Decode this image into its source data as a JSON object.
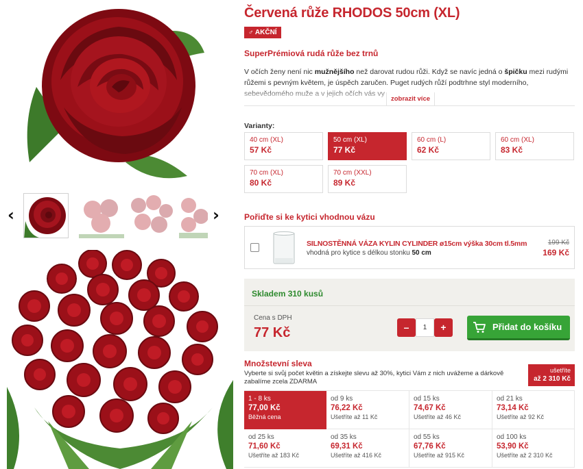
{
  "product": {
    "title": "Červená růže RHODOS 50cm (XL)",
    "badge": "♂ AKČNÍ",
    "subtitle": "SuperPrémiová rudá růže bez trnů",
    "description_parts": {
      "p1": "V očích ženy není nic ",
      "b1": "mužnějšího",
      "p2": " než darovat rudou růži. Když se navíc jedná o ",
      "b2": "špičku",
      "p3": " mezi rudými růžemi s pevným květem, je úspěch zaručen. Puget rudých růží podtrhne styl moderního, sebevědomého muže a v jejich očích vás vy"
    },
    "show_more": "zobrazit více"
  },
  "gallery": {
    "prev_arrow": "‹",
    "next_arrow": "›"
  },
  "variants": {
    "label": "Varianty:",
    "items": [
      {
        "size": "40 cm (XL)",
        "price": "57 Kč",
        "selected": false
      },
      {
        "size": "50 cm (XL)",
        "price": "77 Kč",
        "selected": true
      },
      {
        "size": "60 cm (L)",
        "price": "62 Kč",
        "selected": false
      },
      {
        "size": "60 cm (XL)",
        "price": "83 Kč",
        "selected": false
      },
      {
        "size": "70 cm (XL)",
        "price": "80 Kč",
        "selected": false
      },
      {
        "size": "70 cm (XXL)",
        "price": "89 Kč",
        "selected": false
      }
    ]
  },
  "vase": {
    "heading": "Pořiďte si ke kytici vhodnou vázu",
    "name": "SILNOSTĚNNÁ VÁZA KYLIN CYLINDER ø15cm výška 30cm tl.5mm",
    "note_prefix": "vhodná pro kytice s délkou stonku ",
    "note_bold": "50 cm",
    "old_price": "199 Kč",
    "new_price": "169 Kč"
  },
  "buy": {
    "stock": "Skladem 310 kusů",
    "price_label": "Cena s DPH",
    "price": "77 Kč",
    "minus": "–",
    "plus": "+",
    "quantity": "1",
    "add_to_cart": "Přidat do košíku"
  },
  "quantity_discount": {
    "heading": "Množstevní sleva",
    "description": "Vyberte si svůj počet květin a získejte slevu až 30%, kytici Vám z nich uvážeme a dárkově zabalíme zcela ZDARMA",
    "save_label": "ušetříte",
    "save_value": "až 2 310 Kč",
    "tiers": [
      {
        "range": "1 - 8 ks",
        "price": "77,00 Kč",
        "save": "Běžná cena",
        "active": true
      },
      {
        "range": "od 9 ks",
        "price": "76,22 Kč",
        "save": "Ušetříte až 11 Kč",
        "active": false
      },
      {
        "range": "od 15 ks",
        "price": "74,67 Kč",
        "save": "Ušetříte až 46 Kč",
        "active": false
      },
      {
        "range": "od 21 ks",
        "price": "73,14 Kč",
        "save": "Ušetříte až 92 Kč",
        "active": false
      },
      {
        "range": "od 25 ks",
        "price": "71,60 Kč",
        "save": "Ušetříte až 183 Kč",
        "active": false
      },
      {
        "range": "od 35 ks",
        "price": "69,31 Kč",
        "save": "Ušetříte až 416 Kč",
        "active": false
      },
      {
        "range": "od 55 ks",
        "price": "67,76 Kč",
        "save": "Ušetříte až 915 Kč",
        "active": false
      },
      {
        "range": "od 100 ks",
        "price": "53,90 Kč",
        "save": "Ušetříte až 2 310 Kč",
        "active": false
      }
    ]
  },
  "colors": {
    "brand_red": "#c6262e",
    "stock_green": "#2e8a2e",
    "cart_green": "#37a437"
  }
}
